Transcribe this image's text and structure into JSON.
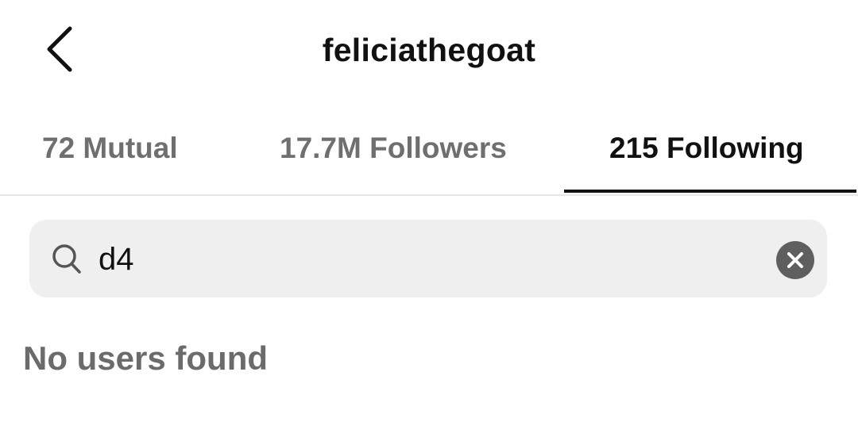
{
  "header": {
    "back_icon": "chevron-left-icon",
    "username": "feliciathegoat"
  },
  "tabs": [
    {
      "label": "72 Mutual",
      "active": false
    },
    {
      "label": "17.7M Followers",
      "active": false
    },
    {
      "label": "215 Following",
      "active": true
    }
  ],
  "search": {
    "icon": "search-icon",
    "value": "d4",
    "clear_icon": "clear-icon"
  },
  "results": {
    "empty_message": "No users found"
  },
  "colors": {
    "background": "#ffffff",
    "text_primary": "#111111",
    "text_secondary": "#6f6f6f",
    "search_bg": "#efefef",
    "clear_btn": "#5f5f5f",
    "divider": "#e6e6e6"
  }
}
